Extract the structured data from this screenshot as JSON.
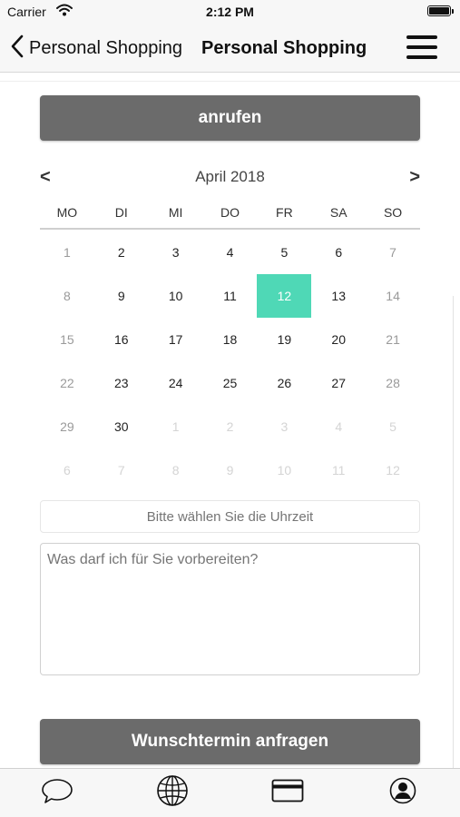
{
  "status_bar": {
    "carrier": "Carrier",
    "time": "2:12 PM"
  },
  "nav": {
    "back_label": "Personal Shopping",
    "title": "Personal Shopping"
  },
  "call_button": "anrufen",
  "calendar": {
    "prev": "<",
    "next": ">",
    "month_label": "April 2018",
    "weekdays": [
      "MO",
      "DI",
      "MI",
      "DO",
      "FR",
      "SA",
      "SO"
    ],
    "selected_day": "12",
    "days": [
      {
        "label": "1",
        "type": "weekend"
      },
      {
        "label": "2",
        "type": "day"
      },
      {
        "label": "3",
        "type": "day"
      },
      {
        "label": "4",
        "type": "day"
      },
      {
        "label": "5",
        "type": "day"
      },
      {
        "label": "6",
        "type": "day"
      },
      {
        "label": "7",
        "type": "weekend"
      },
      {
        "label": "8",
        "type": "weekend"
      },
      {
        "label": "9",
        "type": "day"
      },
      {
        "label": "10",
        "type": "day"
      },
      {
        "label": "11",
        "type": "day"
      },
      {
        "label": "12",
        "type": "selected"
      },
      {
        "label": "13",
        "type": "day"
      },
      {
        "label": "14",
        "type": "weekend"
      },
      {
        "label": "15",
        "type": "weekend"
      },
      {
        "label": "16",
        "type": "day"
      },
      {
        "label": "17",
        "type": "day"
      },
      {
        "label": "18",
        "type": "day"
      },
      {
        "label": "19",
        "type": "day"
      },
      {
        "label": "20",
        "type": "day"
      },
      {
        "label": "21",
        "type": "weekend"
      },
      {
        "label": "22",
        "type": "weekend"
      },
      {
        "label": "23",
        "type": "day"
      },
      {
        "label": "24",
        "type": "day"
      },
      {
        "label": "25",
        "type": "day"
      },
      {
        "label": "26",
        "type": "day"
      },
      {
        "label": "27",
        "type": "day"
      },
      {
        "label": "28",
        "type": "weekend"
      },
      {
        "label": "29",
        "type": "weekend"
      },
      {
        "label": "30",
        "type": "day"
      },
      {
        "label": "1",
        "type": "other"
      },
      {
        "label": "2",
        "type": "other"
      },
      {
        "label": "3",
        "type": "other"
      },
      {
        "label": "4",
        "type": "other"
      },
      {
        "label": "5",
        "type": "other"
      },
      {
        "label": "6",
        "type": "other"
      },
      {
        "label": "7",
        "type": "other"
      },
      {
        "label": "8",
        "type": "other"
      },
      {
        "label": "9",
        "type": "other"
      },
      {
        "label": "10",
        "type": "other"
      },
      {
        "label": "11",
        "type": "other"
      },
      {
        "label": "12",
        "type": "other"
      }
    ]
  },
  "time_select": {
    "placeholder": "Bitte wählen Sie die Uhrzeit"
  },
  "message": {
    "placeholder": "Was darf ich für Sie vorbereiten?"
  },
  "request_button": "Wunschtermin anfragen",
  "tab_bar": {
    "items": [
      "chat-icon",
      "globe-icon",
      "credit-card-icon",
      "user-icon"
    ]
  },
  "colors": {
    "button_bg": "#6b6b6b",
    "selected_day": "#4fd8b6",
    "bar_bg": "#f7f7f7"
  }
}
